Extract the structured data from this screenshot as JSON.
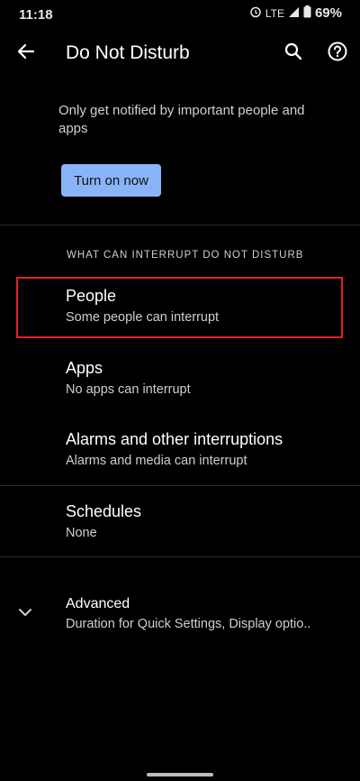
{
  "status_bar": {
    "time": "11:18",
    "network": "LTE",
    "battery": "69%"
  },
  "app_bar": {
    "title": "Do Not Disturb",
    "back_icon": "arrow-back-icon",
    "search_icon": "search-icon",
    "help_icon": "help-icon"
  },
  "intro": {
    "description": "Only get notified by important people and apps",
    "button_label": "Turn on now"
  },
  "section": {
    "header": "WHAT CAN INTERRUPT DO NOT DISTURB"
  },
  "items": [
    {
      "title": "People",
      "subtitle": "Some people can interrupt"
    },
    {
      "title": "Apps",
      "subtitle": "No apps can interrupt"
    },
    {
      "title": "Alarms and other interruptions",
      "subtitle": "Alarms and media can interrupt"
    },
    {
      "title": "Schedules",
      "subtitle": "None"
    }
  ],
  "advanced": {
    "title": "Advanced",
    "subtitle": "Duration for Quick Settings, Display optio..",
    "icon": "chevron-down-icon"
  },
  "colors": {
    "background": "#000000",
    "accent_button": "#8ab4f8",
    "highlight_box": "#e01f2b"
  }
}
